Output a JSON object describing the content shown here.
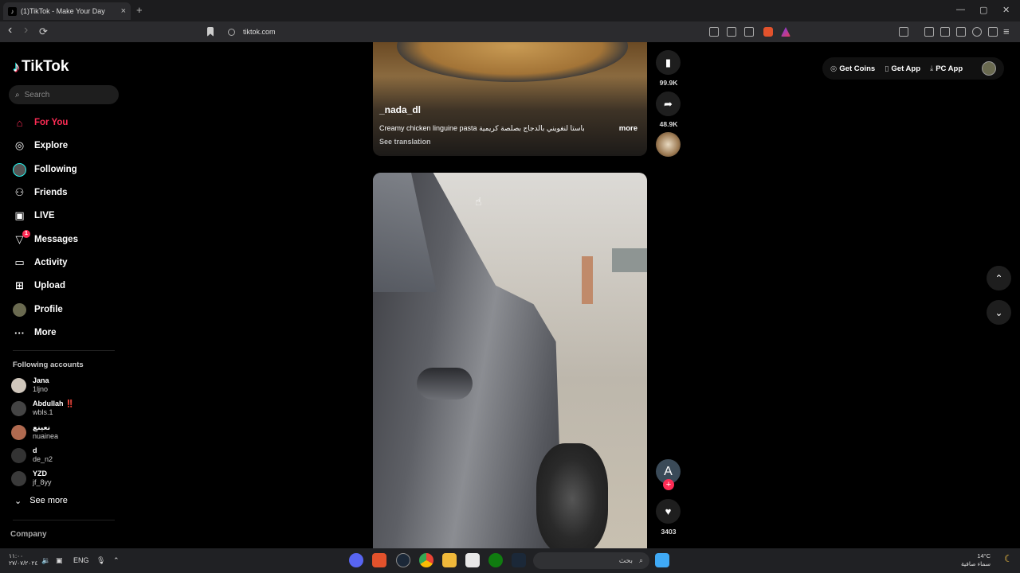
{
  "browser": {
    "tab_title": "(1)TikTok - Make Your Day",
    "tab_close": "×",
    "new_tab": "+",
    "url": "tiktok.com",
    "back": "‹",
    "forward": "›",
    "reload": "⟳",
    "win_min": "—",
    "win_max": "▢",
    "win_close": "✕"
  },
  "sidebar": {
    "logo": "TikTok",
    "search_placeholder": "Search",
    "nav": [
      {
        "label": "For You",
        "icon": "home-icon"
      },
      {
        "label": "Explore",
        "icon": "compass-icon"
      },
      {
        "label": "Following",
        "icon": "following-icon"
      },
      {
        "label": "Friends",
        "icon": "friends-icon"
      },
      {
        "label": "LIVE",
        "icon": "live-icon"
      },
      {
        "label": "Messages",
        "icon": "messages-icon",
        "badge": "1"
      },
      {
        "label": "Activity",
        "icon": "activity-icon"
      },
      {
        "label": "Upload",
        "icon": "upload-icon"
      },
      {
        "label": "Profile",
        "icon": "profile-icon"
      },
      {
        "label": "More",
        "icon": "more-icon"
      }
    ],
    "following_title": "Following accounts",
    "accounts": [
      {
        "name": "Jana",
        "handle": "1ljno"
      },
      {
        "name": "Abdullah ‼️",
        "handle": "wbls.1"
      },
      {
        "name": "نعينع",
        "handle": "nuainea"
      },
      {
        "name": "d",
        "handle": "de_n2"
      },
      {
        "name": "YZD",
        "handle": "jf_8yy"
      }
    ],
    "see_more": "See more",
    "company": "Company"
  },
  "video1": {
    "author": "_nada_dl",
    "description": "Creamy chicken linguine pasta باستا لنغويني بالدجاج بصلصة كريمية",
    "more": "more",
    "see_translation": "See translation",
    "bookmarks": "99.9K",
    "shares": "48.9K"
  },
  "video2": {
    "avatar_letter": "A",
    "likes": "3403"
  },
  "topbar": {
    "get_coins": "Get Coins",
    "get_app": "Get App",
    "pc_app": "PC App"
  },
  "taskbar": {
    "time_left": "١١:٠٠",
    "date_left": "٢٧/٠٧/٢٠٢٤",
    "lang": "ENG",
    "search_text": "بحث",
    "weather_temp": "14°C",
    "weather_desc": "سماء صافية"
  },
  "colors": {
    "accent": "#fe2c55",
    "background": "#000000",
    "panel": "#1e1e1e"
  }
}
